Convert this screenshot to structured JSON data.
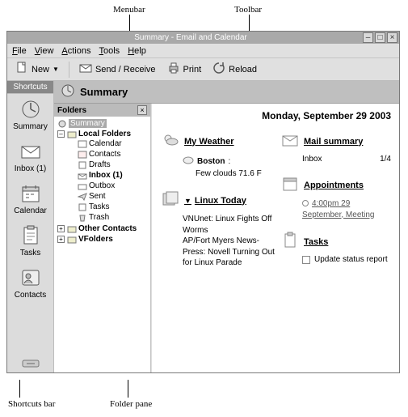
{
  "annotations": {
    "menubar": "Menubar",
    "toolbar": "Toolbar",
    "shortcuts_bar": "Shortcuts bar",
    "folder_pane": "Folder pane"
  },
  "window": {
    "title": "Summary - Email and Calendar",
    "minimize": "–",
    "maximize": "□",
    "close": "×"
  },
  "menubar": {
    "file": "File",
    "view": "View",
    "actions": "Actions",
    "tools": "Tools",
    "help": "Help"
  },
  "toolbar": {
    "new": "New",
    "send_receive": "Send / Receive",
    "print": "Print",
    "reload": "Reload"
  },
  "shortcuts": {
    "header": "Shortcuts",
    "summary": "Summary",
    "inbox": "Inbox (1)",
    "calendar": "Calendar",
    "tasks": "Tasks",
    "contacts": "Contacts"
  },
  "summary_header": "Summary",
  "folders": {
    "header": "Folders",
    "close": "×",
    "summary": "Summary",
    "local": "Local Folders",
    "calendar": "Calendar",
    "contacts": "Contacts",
    "drafts": "Drafts",
    "inbox": "Inbox (1)",
    "outbox": "Outbox",
    "sent": "Sent",
    "tasks": "Tasks",
    "trash": "Trash",
    "other_contacts": "Other Contacts",
    "vfolders": "VFolders"
  },
  "view": {
    "date": "Monday, September 29 2003",
    "weather": {
      "title": "My Weather",
      "city": "Boston",
      "cond": "Few clouds 71.6 F"
    },
    "news": {
      "title": "Linux Today",
      "items": "VNUnet: Linux Fights Off Worms\nAP/Fort Myers News-Press: Novell Turning Out for Linux Parade"
    },
    "mail": {
      "title": "Mail summary",
      "inbox_label": "Inbox",
      "inbox_count": "1/4"
    },
    "appointments": {
      "title": "Appointments",
      "item": "4:00pm 29 September, Meeting"
    },
    "tasks": {
      "title": "Tasks",
      "item": "Update status report"
    }
  }
}
